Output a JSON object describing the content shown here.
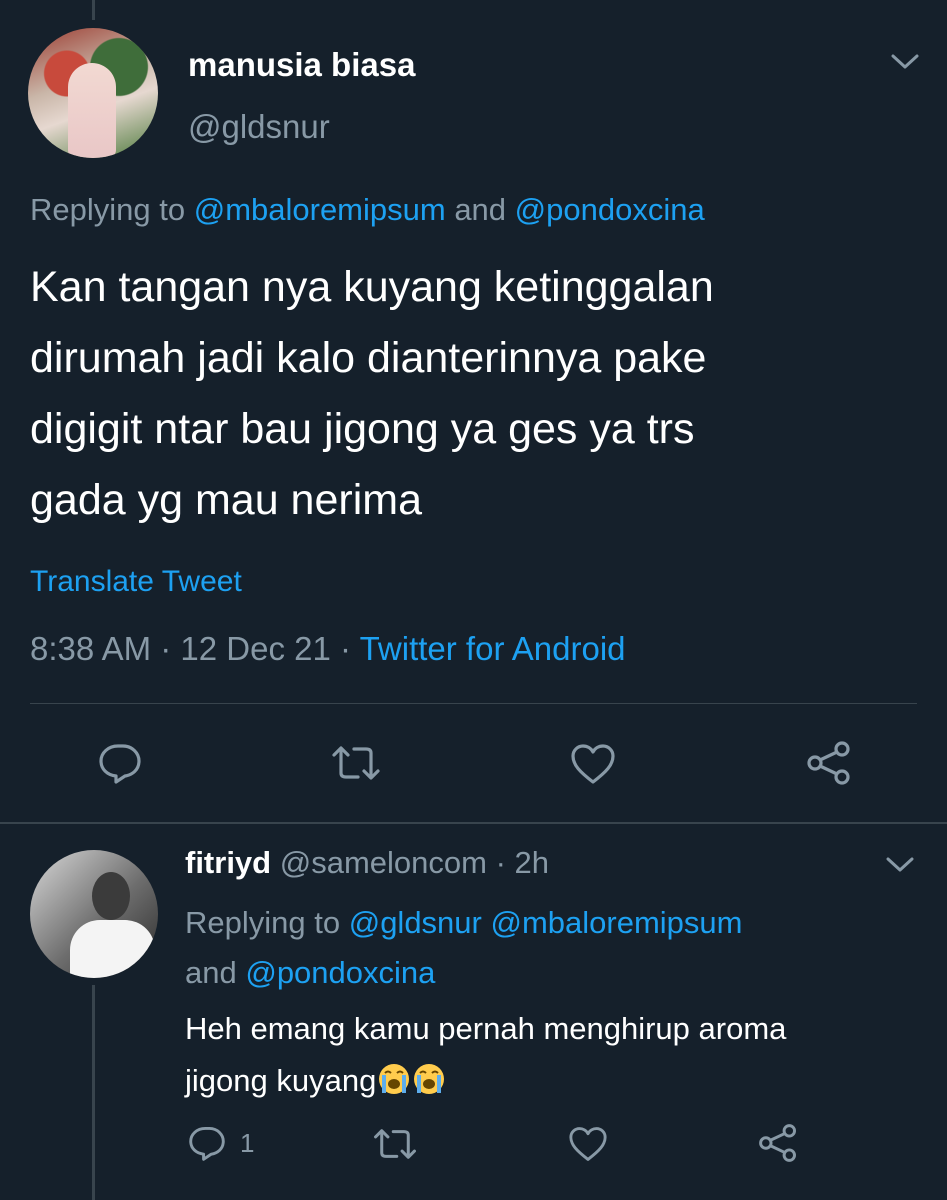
{
  "main_tweet": {
    "display_name": "manusia biasa",
    "handle": "@gldsnur",
    "replying_prefix": "Replying to ",
    "replying_mention_1": "@mbaloremipsum",
    "replying_and": " and ",
    "replying_mention_2": "@pondoxcina",
    "text_lines": [
      "Kan tangan nya kuyang ketinggalan",
      "dirumah jadi kalo dianterinnya pake",
      "digigit ntar bau jigong ya ges ya trs",
      "gada yg mau nerima"
    ],
    "translate_label": "Translate Tweet",
    "time": "8:38 AM",
    "date": "12 Dec 21",
    "separator": " · ",
    "source": "Twitter for Android"
  },
  "reply_tweet": {
    "display_name": "fitriyd",
    "handle": "@sameloncom",
    "time": "2h",
    "separator": " · ",
    "replying_prefix": "Replying to ",
    "replying_mention_1": "@gldsnur",
    "replying_mention_2": "@mbaloremipsum",
    "replying_and": "and ",
    "replying_mention_3": "@pondoxcina",
    "text_line_1": "Heh emang kamu pernah menghirup aroma",
    "text_line_2": "jigong kuyang",
    "emoji_names": [
      "loudly-crying-face-icon",
      "loudly-crying-face-icon"
    ],
    "reply_count": "1"
  },
  "icons": {
    "caret": "chevron-down-icon",
    "reply": "reply-icon",
    "retweet": "retweet-icon",
    "like": "heart-icon",
    "share": "share-icon"
  },
  "colors": {
    "background": "#15202b",
    "text": "#ffffff",
    "muted": "#8899a6",
    "link": "#1da1f2",
    "divider": "#38444d"
  }
}
